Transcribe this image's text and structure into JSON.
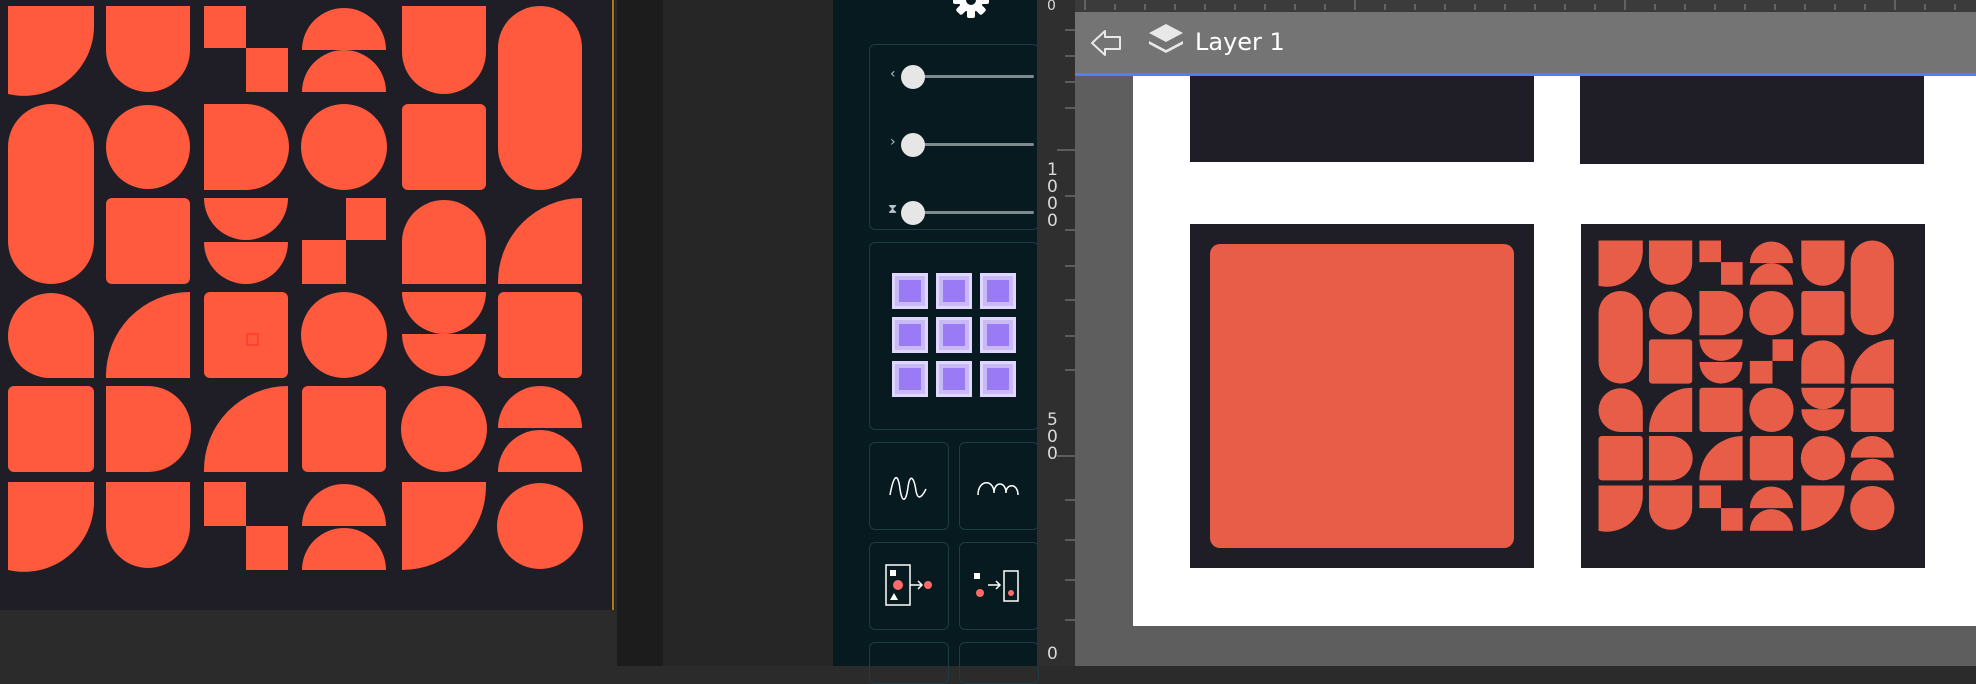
{
  "toolbar": {
    "back_icon": "back-arrow-icon",
    "layers_icon": "layers-icon",
    "layer_name": "Layer 1"
  },
  "ruler": {
    "labels": [
      "0",
      "1000",
      "500",
      "0"
    ]
  },
  "tools": {
    "gear_icon": "gear-icon",
    "sliders": [
      {
        "icon": "chevron-left-icon",
        "glyph": "‹",
        "value": 0
      },
      {
        "icon": "chevron-right-icon",
        "glyph": "›",
        "value": 0
      },
      {
        "icon": "hourglass-icon",
        "glyph": "⧗",
        "value": 0
      }
    ],
    "grid_icon": "alignment-grid-icon",
    "shape_buttons": [
      "wave-icon",
      "bumps-icon",
      "shape-to-dot-icon",
      "dot-to-shape-icon"
    ]
  },
  "colors": {
    "accent": "#ff5a3e",
    "dark_tile": "#1f1e26",
    "purple": "#9b7bf5",
    "panel_bg": "#061a1f",
    "toolbar_line": "#4e7ff6"
  }
}
